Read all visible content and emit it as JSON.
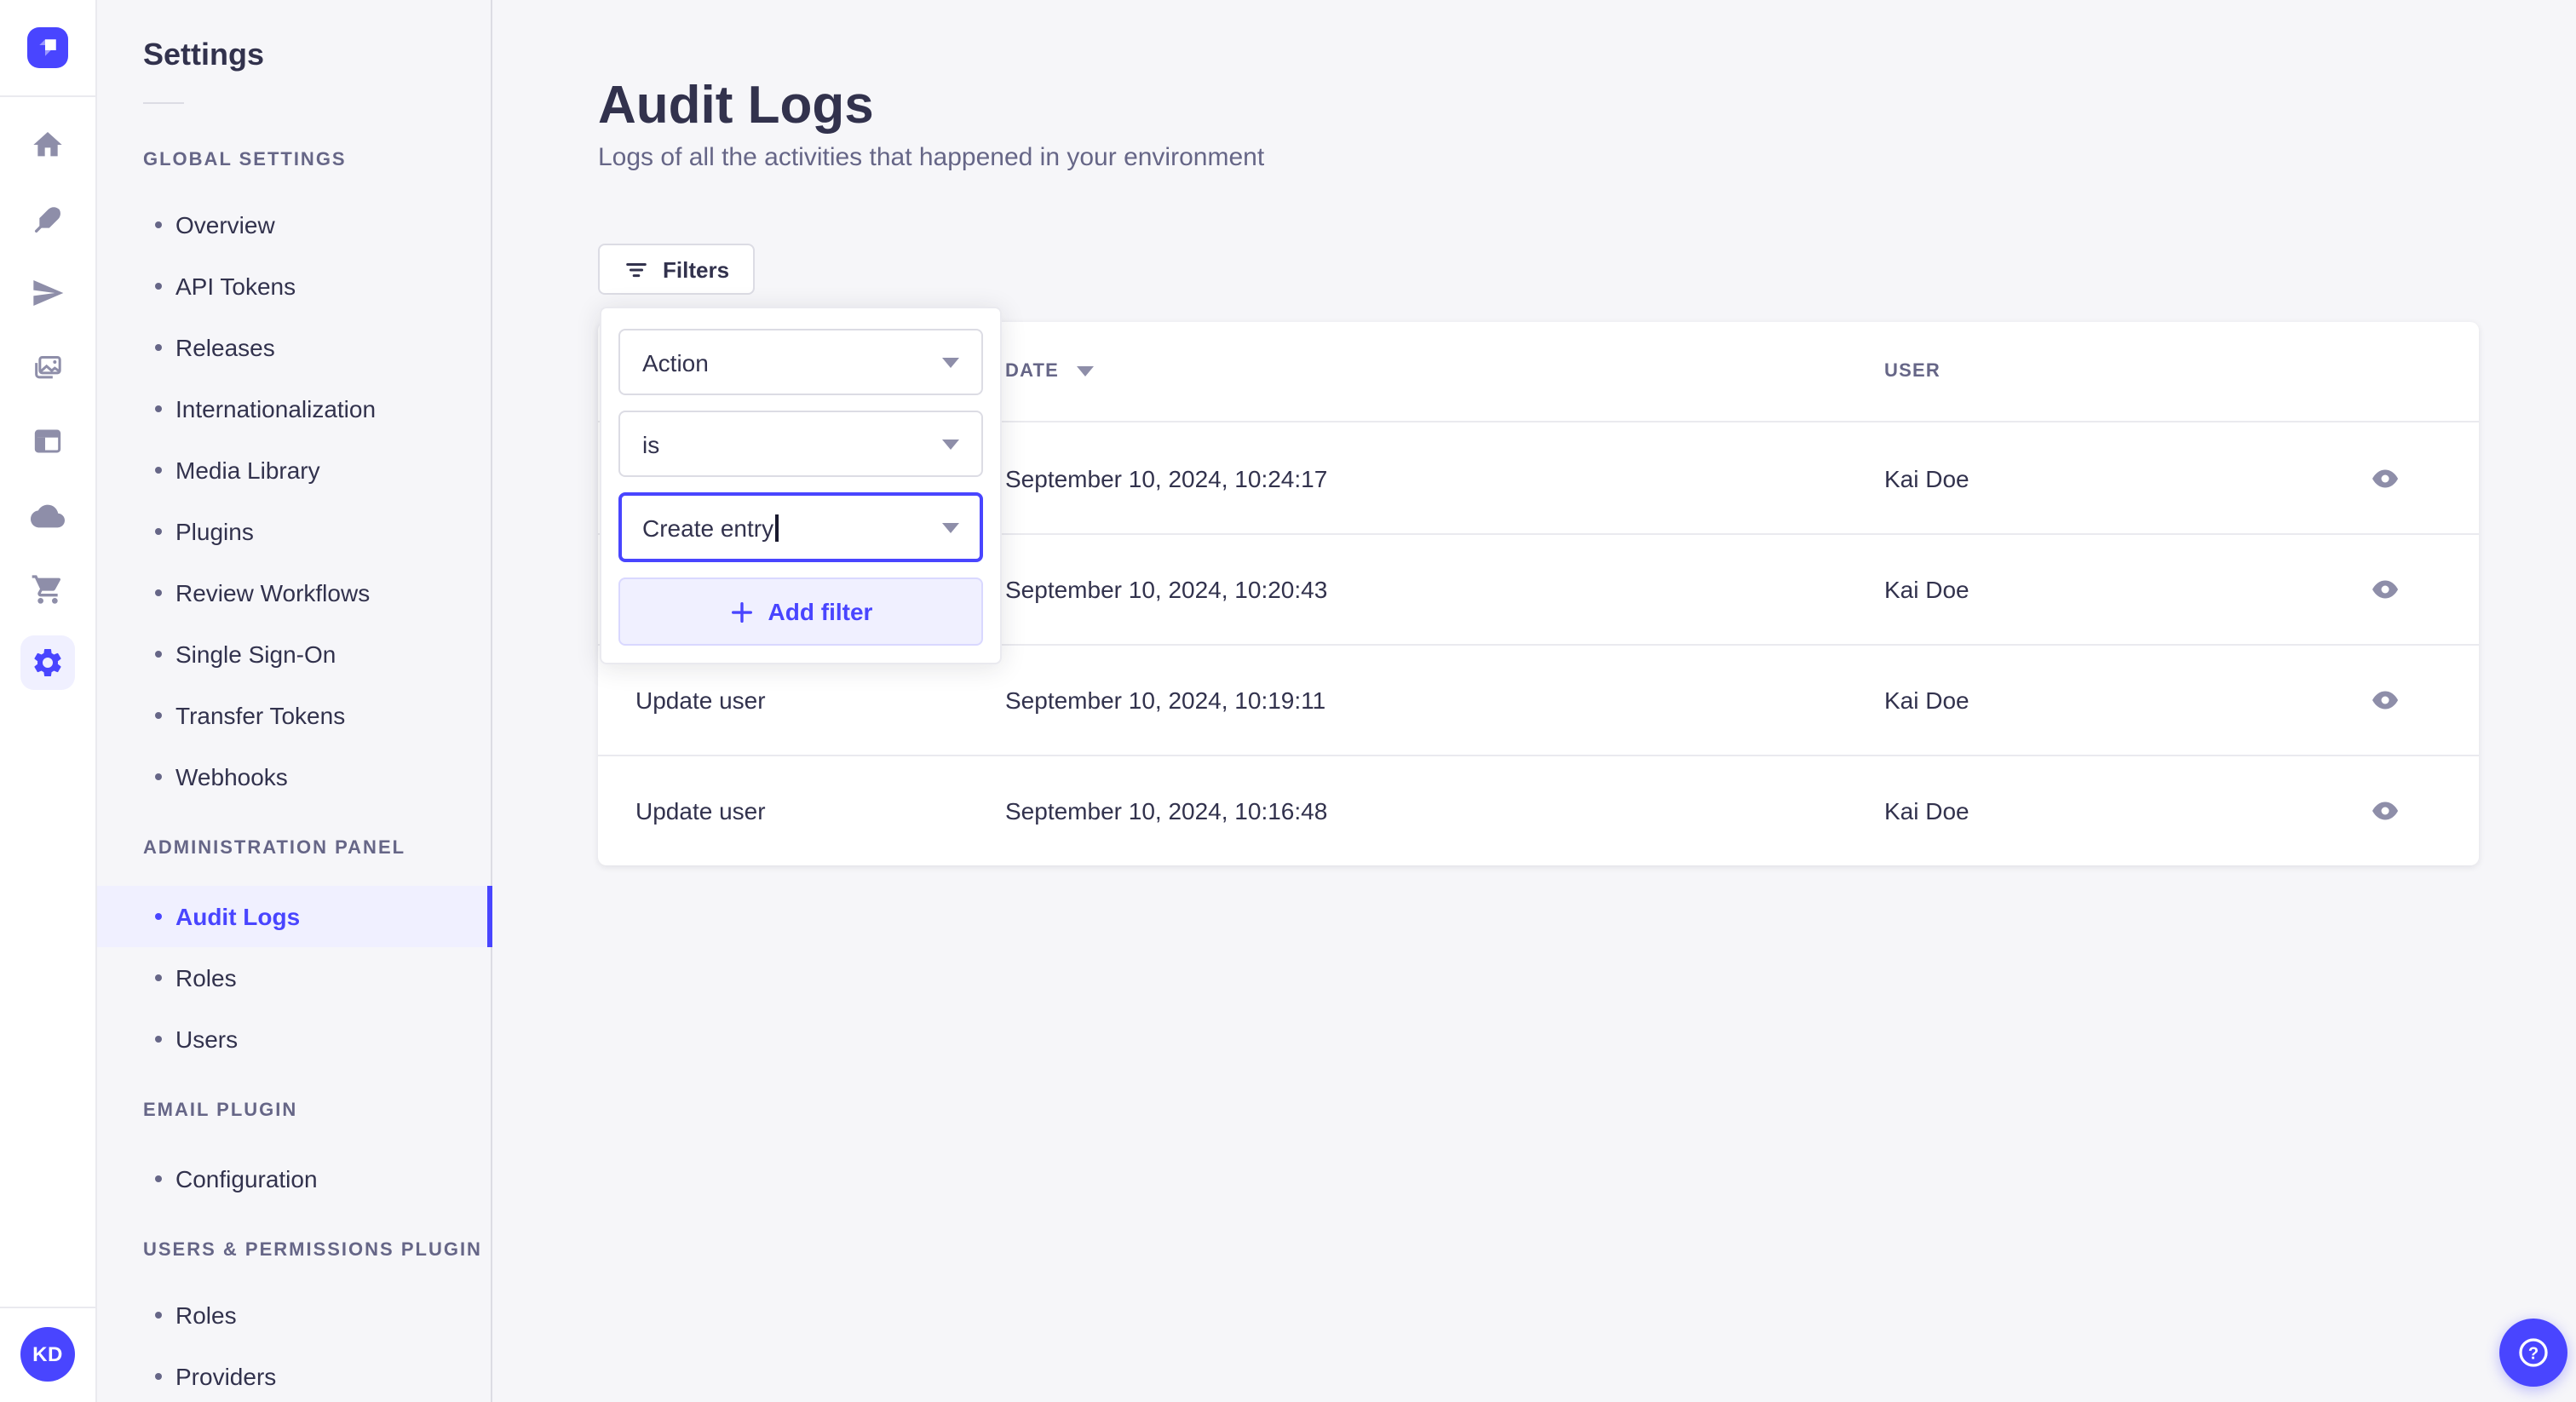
{
  "brand": {
    "name": "Strapi",
    "initials": "KD"
  },
  "colors": {
    "accent": "#4945ff",
    "accent_light_bg": "#f0f0ff",
    "accent_border": "#d9d8ff",
    "text_dark": "#32324d",
    "text_gray": "#666687",
    "icon_gray": "#8e8ea9",
    "border_light": "#eaeaef",
    "border_mid": "#dcdce4",
    "page_bg": "#f6f6f9"
  },
  "rail": {
    "avatar_initials": "KD",
    "items": [
      {
        "name": "home-icon"
      },
      {
        "name": "content-manager-icon"
      },
      {
        "name": "releases-icon"
      },
      {
        "name": "media-library-icon"
      },
      {
        "name": "content-type-builder-icon"
      },
      {
        "name": "cloud-icon"
      },
      {
        "name": "marketplace-icon"
      },
      {
        "name": "settings-icon",
        "active": true
      }
    ]
  },
  "sidebar": {
    "title": "Settings",
    "sections": [
      {
        "label": "GLOBAL SETTINGS",
        "items": [
          "Overview",
          "API Tokens",
          "Releases",
          "Internationalization",
          "Media Library",
          "Plugins",
          "Review Workflows",
          "Single Sign-On",
          "Transfer Tokens",
          "Webhooks"
        ]
      },
      {
        "label": "ADMINISTRATION PANEL",
        "items": [
          "Audit Logs",
          "Roles",
          "Users"
        ],
        "active_item": "Audit Logs"
      },
      {
        "label": "EMAIL PLUGIN",
        "items": [
          "Configuration"
        ]
      },
      {
        "label": "USERS & PERMISSIONS PLUGIN",
        "items": [
          "Roles",
          "Providers"
        ]
      }
    ]
  },
  "page": {
    "title": "Audit Logs",
    "subtitle": "Logs of all the activities that happened in your environment",
    "filters_label": "Filters"
  },
  "popover": {
    "field": "Action",
    "operator": "is",
    "value": "Create entry",
    "add_filter_label": "Add filter"
  },
  "table": {
    "headers": {
      "action": "",
      "date": "DATE",
      "user": "USER"
    },
    "rows": [
      {
        "action": "",
        "date": "September 10, 2024, 10:24:17",
        "user": "Kai Doe"
      },
      {
        "action": "",
        "date": "September 10, 2024, 10:20:43",
        "user": "Kai Doe"
      },
      {
        "action": "Update user",
        "date": "September 10, 2024, 10:19:11",
        "user": "Kai Doe"
      },
      {
        "action": "Update user",
        "date": "September 10, 2024, 10:16:48",
        "user": "Kai Doe"
      }
    ]
  }
}
